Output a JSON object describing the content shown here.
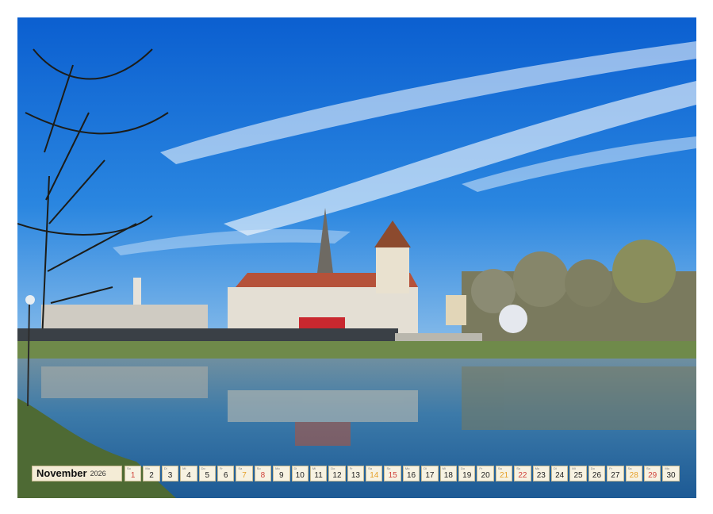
{
  "calendar": {
    "month": "November",
    "year": "2026",
    "days": [
      {
        "dow": "So",
        "num": "1",
        "type": "sun"
      },
      {
        "dow": "Mo",
        "num": "2",
        "type": "week"
      },
      {
        "dow": "Di",
        "num": "3",
        "type": "week"
      },
      {
        "dow": "Mi",
        "num": "4",
        "type": "week"
      },
      {
        "dow": "Do",
        "num": "5",
        "type": "week"
      },
      {
        "dow": "Fr",
        "num": "6",
        "type": "week"
      },
      {
        "dow": "Sa",
        "num": "7",
        "type": "sat"
      },
      {
        "dow": "So",
        "num": "8",
        "type": "sun"
      },
      {
        "dow": "Mo",
        "num": "9",
        "type": "week"
      },
      {
        "dow": "Di",
        "num": "10",
        "type": "week"
      },
      {
        "dow": "Mi",
        "num": "11",
        "type": "week"
      },
      {
        "dow": "Do",
        "num": "12",
        "type": "week"
      },
      {
        "dow": "Fr",
        "num": "13",
        "type": "week"
      },
      {
        "dow": "Sa",
        "num": "14",
        "type": "sat"
      },
      {
        "dow": "So",
        "num": "15",
        "type": "sun"
      },
      {
        "dow": "Mo",
        "num": "16",
        "type": "week"
      },
      {
        "dow": "Di",
        "num": "17",
        "type": "week"
      },
      {
        "dow": "Mi",
        "num": "18",
        "type": "week"
      },
      {
        "dow": "Do",
        "num": "19",
        "type": "week"
      },
      {
        "dow": "Fr",
        "num": "20",
        "type": "week"
      },
      {
        "dow": "Sa",
        "num": "21",
        "type": "sat"
      },
      {
        "dow": "So",
        "num": "22",
        "type": "sun"
      },
      {
        "dow": "Mo",
        "num": "23",
        "type": "week"
      },
      {
        "dow": "Di",
        "num": "24",
        "type": "week"
      },
      {
        "dow": "Mi",
        "num": "25",
        "type": "week"
      },
      {
        "dow": "Do",
        "num": "26",
        "type": "week"
      },
      {
        "dow": "Fr",
        "num": "27",
        "type": "week"
      },
      {
        "dow": "Sa",
        "num": "28",
        "type": "sat"
      },
      {
        "dow": "So",
        "num": "29",
        "type": "sun"
      },
      {
        "dow": "Mo",
        "num": "30",
        "type": "week"
      }
    ]
  },
  "colors": {
    "sky": "#1c6fd4",
    "river": "#3a78a8",
    "roof": "#b5523a",
    "saturday": "#e6a028",
    "sunday": "#d0423a"
  }
}
